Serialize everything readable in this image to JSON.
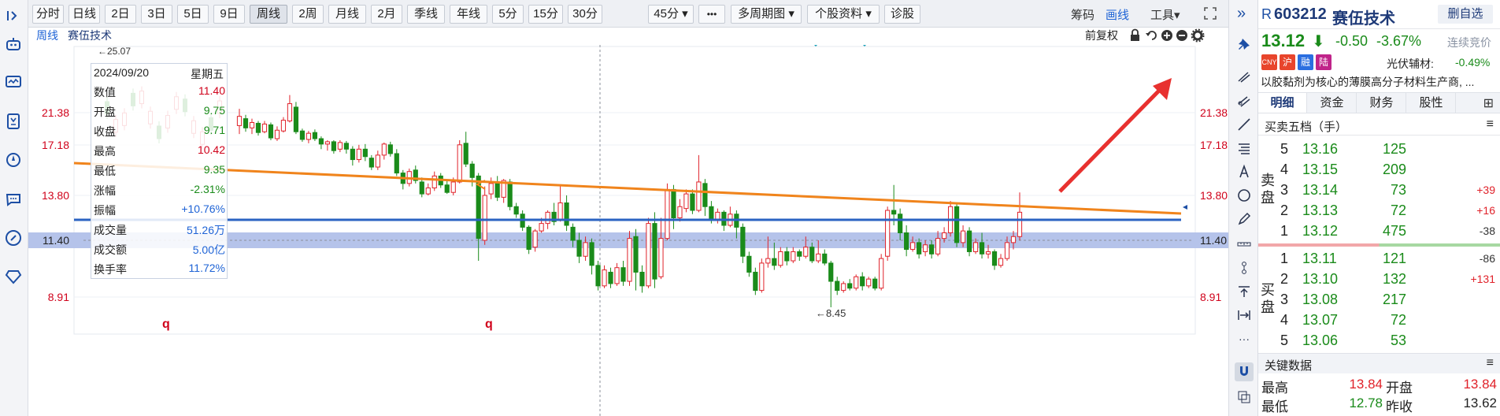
{
  "toolbar": {
    "periods": [
      {
        "label": "分时",
        "active": false
      },
      {
        "label": "日线",
        "active": false
      },
      {
        "label": "2日",
        "active": false
      },
      {
        "label": "3日",
        "active": false
      },
      {
        "label": "5日",
        "active": false
      },
      {
        "label": "9日",
        "active": false
      },
      {
        "label": "周线",
        "active": true
      },
      {
        "label": "2周",
        "active": false
      },
      {
        "label": "月线",
        "active": false
      },
      {
        "label": "2月",
        "active": false
      },
      {
        "label": "季线",
        "active": false
      },
      {
        "label": "年线",
        "active": false
      },
      {
        "label": "5分",
        "active": false
      },
      {
        "label": "15分",
        "active": false
      },
      {
        "label": "30分",
        "active": false
      }
    ],
    "dropdown_45": "45分",
    "more": "•••",
    "multi_period": "多周期图",
    "stock_info": "个股资料",
    "diagnose": "诊股",
    "chips": "筹码",
    "draw_line": "画线",
    "tools": "工具"
  },
  "subbar": {
    "period": "周线",
    "stock_name": "赛伍技术",
    "adjust": "前复权"
  },
  "info_panel": {
    "date": "2024/09/20",
    "weekday": "星期五",
    "rows": [
      {
        "k": "数值",
        "v": "11.40",
        "c": "#d0021b"
      },
      {
        "k": "开盘",
        "v": "9.75",
        "c": "#1a8b1a"
      },
      {
        "k": "收盘",
        "v": "9.71",
        "c": "#1a8b1a"
      },
      {
        "k": "最高",
        "v": "10.42",
        "c": "#d0021b"
      },
      {
        "k": "最低",
        "v": "9.35",
        "c": "#1a8b1a"
      },
      {
        "k": "涨幅",
        "v": "-2.31%",
        "c": "#1a8b1a"
      },
      {
        "k": "振幅",
        "v": "+10.76%",
        "c": "#1e63d6"
      },
      {
        "k": "成交量",
        "v": "51.26万",
        "c": "#1e63d6"
      },
      {
        "k": "成交额",
        "v": "5.00亿",
        "c": "#1e63d6"
      },
      {
        "k": "换手率",
        "v": "11.72%",
        "c": "#1e63d6"
      }
    ]
  },
  "chart_data": {
    "type": "candlestick",
    "y_ticks": [
      "21.38",
      "17.18",
      "13.80",
      "11.40",
      "8.91"
    ],
    "cursor_price": "11.40",
    "high_label": "25.07",
    "low_label": "8.45",
    "markers": [
      "q",
      "q"
    ],
    "candles": [
      [
        19.7,
        20.9,
        21.6,
        18.6
      ],
      [
        20.6,
        19.4,
        21.1,
        18.9
      ],
      [
        19.4,
        20.1,
        20.6,
        18.6
      ],
      [
        20.0,
        18.8,
        20.3,
        18.4
      ],
      [
        18.9,
        19.9,
        20.3,
        18.7
      ],
      [
        19.8,
        18.1,
        20.1,
        17.8
      ],
      [
        18.0,
        19.1,
        19.6,
        17.7
      ],
      [
        19.0,
        20.4,
        20.8,
        18.8
      ],
      [
        20.3,
        21.9,
        22.4,
        20.1
      ],
      [
        21.7,
        18.9,
        22.0,
        18.6
      ],
      [
        19.0,
        17.9,
        19.3,
        17.6
      ],
      [
        17.9,
        18.7,
        19.0,
        17.4
      ],
      [
        18.8,
        18.0,
        19.2,
        17.7
      ],
      [
        18.0,
        17.3,
        18.3,
        16.9
      ],
      [
        17.3,
        17.6,
        17.8,
        16.8
      ],
      [
        17.6,
        16.8,
        17.8,
        16.6
      ],
      [
        16.9,
        17.5,
        17.8,
        16.7
      ],
      [
        17.4,
        16.9,
        17.7,
        16.6
      ],
      [
        16.9,
        16.2,
        17.1,
        15.8
      ],
      [
        16.2,
        16.9,
        17.2,
        16.0
      ],
      [
        16.9,
        16.4,
        17.3,
        16.1
      ],
      [
        16.3,
        15.7,
        16.5,
        15.5
      ],
      [
        15.7,
        16.5,
        16.8,
        15.5
      ],
      [
        16.5,
        17.3,
        17.5,
        16.2
      ],
      [
        17.2,
        16.6,
        17.6,
        16.4
      ],
      [
        16.6,
        15.3,
        16.9,
        15.1
      ],
      [
        15.3,
        14.6,
        15.5,
        14.2
      ],
      [
        14.6,
        15.4,
        15.6,
        14.4
      ],
      [
        15.5,
        14.8,
        15.8,
        14.6
      ],
      [
        14.7,
        13.9,
        15.0,
        13.7
      ],
      [
        13.9,
        14.3,
        14.6,
        13.8
      ],
      [
        14.3,
        15.1,
        15.4,
        14.1
      ],
      [
        15.1,
        14.5,
        15.3,
        14.3
      ],
      [
        14.5,
        14.0,
        14.8,
        13.9
      ],
      [
        14.0,
        14.7,
        15.0,
        13.8
      ],
      [
        14.7,
        17.2,
        17.8,
        14.6
      ],
      [
        17.4,
        15.9,
        18.9,
        15.7
      ],
      [
        15.9,
        15.0,
        16.1,
        14.4
      ],
      [
        15.1,
        11.5,
        15.3,
        10.5
      ],
      [
        11.4,
        13.8,
        14.4,
        11.2
      ],
      [
        13.9,
        14.6,
        15.0,
        13.6
      ],
      [
        14.6,
        13.7,
        15.1,
        13.5
      ],
      [
        13.7,
        14.8,
        14.9,
        13.4
      ],
      [
        14.7,
        13.2,
        14.9,
        13.0
      ],
      [
        13.2,
        12.8,
        13.4,
        12.6
      ],
      [
        12.8,
        12.1,
        13.0,
        11.9
      ],
      [
        12.1,
        11.0,
        12.2,
        10.8
      ],
      [
        11.1,
        11.9,
        12.0,
        10.9
      ],
      [
        11.9,
        12.3,
        12.6,
        11.8
      ],
      [
        12.3,
        12.9,
        13.0,
        12.0
      ],
      [
        12.9,
        12.4,
        13.4,
        12.2
      ],
      [
        12.5,
        13.4,
        14.5,
        12.4
      ],
      [
        13.4,
        12.2,
        13.8,
        11.9
      ],
      [
        12.1,
        11.4,
        12.3,
        11.1
      ],
      [
        11.4,
        10.7,
        11.8,
        10.4
      ],
      [
        10.7,
        11.3,
        11.6,
        10.5
      ],
      [
        11.3,
        10.3,
        11.5,
        9.9
      ],
      [
        10.3,
        9.4,
        10.5,
        9.2
      ],
      [
        9.4,
        10.1,
        10.3,
        9.3
      ],
      [
        10.0,
        9.5,
        10.2,
        9.3
      ],
      [
        9.5,
        10.2,
        10.4,
        9.4
      ],
      [
        10.2,
        9.6,
        10.5,
        9.4
      ],
      [
        9.6,
        11.5,
        11.9,
        9.4
      ],
      [
        11.6,
        10.0,
        12.0,
        9.2
      ],
      [
        10.0,
        9.4,
        10.3,
        9.1
      ],
      [
        9.4,
        12.3,
        12.6,
        9.3
      ],
      [
        12.3,
        9.7,
        12.9,
        9.3
      ],
      [
        9.8,
        11.5,
        12.6,
        9.7
      ],
      [
        11.5,
        14.2,
        14.6,
        11.4
      ],
      [
        14.2,
        12.6,
        14.5,
        12.0
      ],
      [
        12.6,
        13.2,
        13.6,
        12.4
      ],
      [
        13.1,
        13.9,
        14.2,
        12.9
      ],
      [
        13.9,
        13.0,
        14.2,
        12.8
      ],
      [
        13.0,
        14.7,
        16.5,
        12.9
      ],
      [
        14.6,
        13.2,
        14.9,
        12.7
      ],
      [
        13.2,
        12.5,
        13.5,
        12.3
      ],
      [
        12.5,
        12.9,
        13.1,
        12.3
      ],
      [
        12.9,
        12.2,
        13.0,
        11.9
      ],
      [
        12.2,
        12.8,
        13.2,
        12.1
      ],
      [
        12.8,
        12.1,
        13.0,
        11.5
      ],
      [
        12.1,
        10.7,
        12.3,
        10.4
      ],
      [
        10.7,
        10.0,
        10.9,
        9.8
      ],
      [
        10.0,
        9.2,
        10.2,
        9.0
      ],
      [
        9.2,
        10.4,
        10.6,
        9.1
      ],
      [
        10.4,
        10.6,
        11.6,
        10.2
      ],
      [
        10.6,
        10.3,
        11.3,
        10.1
      ],
      [
        10.3,
        10.9,
        11.1,
        10.2
      ],
      [
        10.9,
        10.5,
        11.1,
        10.3
      ],
      [
        10.5,
        10.9,
        11.1,
        10.4
      ],
      [
        10.9,
        10.7,
        11.0,
        10.5
      ],
      [
        10.7,
        11.1,
        11.6,
        10.6
      ],
      [
        11.1,
        10.5,
        11.3,
        10.4
      ],
      [
        10.5,
        10.8,
        11.4,
        10.4
      ],
      [
        10.8,
        10.4,
        11.0,
        10.3
      ],
      [
        10.4,
        9.6,
        10.5,
        8.45
      ],
      [
        9.6,
        9.2,
        9.8,
        9.0
      ],
      [
        9.2,
        9.5,
        9.6,
        9.1
      ],
      [
        9.5,
        9.3,
        9.7,
        9.2
      ],
      [
        9.3,
        9.8,
        9.9,
        9.2
      ],
      [
        9.8,
        9.4,
        10.0,
        9.2
      ],
      [
        9.4,
        9.7,
        9.8,
        9.3
      ],
      [
        9.7,
        9.3,
        9.8,
        9.2
      ],
      [
        9.3,
        10.6,
        10.8,
        9.2
      ],
      [
        10.7,
        13.0,
        13.2,
        10.5
      ],
      [
        13.0,
        12.8,
        14.5,
        12.2
      ],
      [
        12.8,
        11.8,
        13.1,
        11.4
      ],
      [
        11.8,
        11.0,
        12.2,
        10.7
      ],
      [
        11.0,
        11.3,
        11.6,
        10.9
      ],
      [
        11.3,
        10.8,
        11.5,
        10.6
      ],
      [
        10.9,
        11.2,
        11.4,
        10.7
      ],
      [
        11.2,
        10.8,
        11.4,
        10.6
      ],
      [
        10.8,
        11.5,
        11.9,
        10.7
      ],
      [
        11.5,
        11.8,
        12.1,
        11.3
      ],
      [
        11.8,
        13.2,
        13.5,
        11.6
      ],
      [
        13.2,
        11.3,
        13.4,
        11.1
      ],
      [
        11.3,
        11.9,
        12.2,
        11.1
      ],
      [
        11.9,
        10.9,
        12.1,
        10.7
      ],
      [
        10.9,
        11.3,
        11.5,
        10.8
      ],
      [
        11.3,
        10.8,
        11.8,
        10.6
      ],
      [
        10.8,
        10.9,
        11.2,
        10.6
      ],
      [
        10.9,
        10.3,
        11.0,
        10.1
      ],
      [
        10.3,
        10.6,
        10.8,
        10.2
      ],
      [
        10.6,
        11.3,
        11.6,
        10.5
      ],
      [
        11.3,
        11.6,
        11.9,
        11.0
      ],
      [
        11.6,
        12.9,
        14.0,
        11.4
      ]
    ]
  },
  "quote": {
    "prefix": "R",
    "code": "603212",
    "name": "赛伍技术",
    "del_btn": "删自选",
    "price": "13.12",
    "arrow": "⬇",
    "change": "-0.50",
    "pct": "-3.67%",
    "compete": "连续竞价",
    "badges": [
      "CNY",
      "沪",
      "融",
      "陆"
    ],
    "sector": "光伏辅材:",
    "sector_pct": "-0.49%",
    "desc": "以胶黏剂为核心的薄膜高分子材料生产商, ..."
  },
  "tabs": [
    "明细",
    "资金",
    "财务",
    "股性"
  ],
  "orderbook": {
    "title": "买卖五档（手）",
    "sell_label": "卖盘",
    "buy_label": "买盘",
    "asks": [
      {
        "lvl": "5",
        "price": "13.16",
        "vol": "125",
        "chg": ""
      },
      {
        "lvl": "4",
        "price": "13.15",
        "vol": "209",
        "chg": ""
      },
      {
        "lvl": "3",
        "price": "13.14",
        "vol": "73",
        "chg": "+39"
      },
      {
        "lvl": "2",
        "price": "13.13",
        "vol": "72",
        "chg": "+16"
      },
      {
        "lvl": "1",
        "price": "13.12",
        "vol": "475",
        "chg": "-38"
      }
    ],
    "bids": [
      {
        "lvl": "1",
        "price": "13.11",
        "vol": "121",
        "chg": "-86"
      },
      {
        "lvl": "2",
        "price": "13.10",
        "vol": "132",
        "chg": "+131"
      },
      {
        "lvl": "3",
        "price": "13.08",
        "vol": "217",
        "chg": ""
      },
      {
        "lvl": "4",
        "price": "13.07",
        "vol": "72",
        "chg": ""
      },
      {
        "lvl": "5",
        "price": "13.06",
        "vol": "53",
        "chg": ""
      }
    ]
  },
  "key_data": {
    "title": "关键数据",
    "high_label": "最高",
    "high": "13.84",
    "open_label": "开盘",
    "open": "13.84",
    "low_label": "最低",
    "low": "12.78",
    "prev_label": "昨收",
    "prev": "13.62"
  },
  "colors": {
    "up": "#e0222a",
    "down": "#1a8b1a",
    "blue": "#1e63d6",
    "orange": "#f0841c",
    "blueline": "#2b63c2"
  }
}
